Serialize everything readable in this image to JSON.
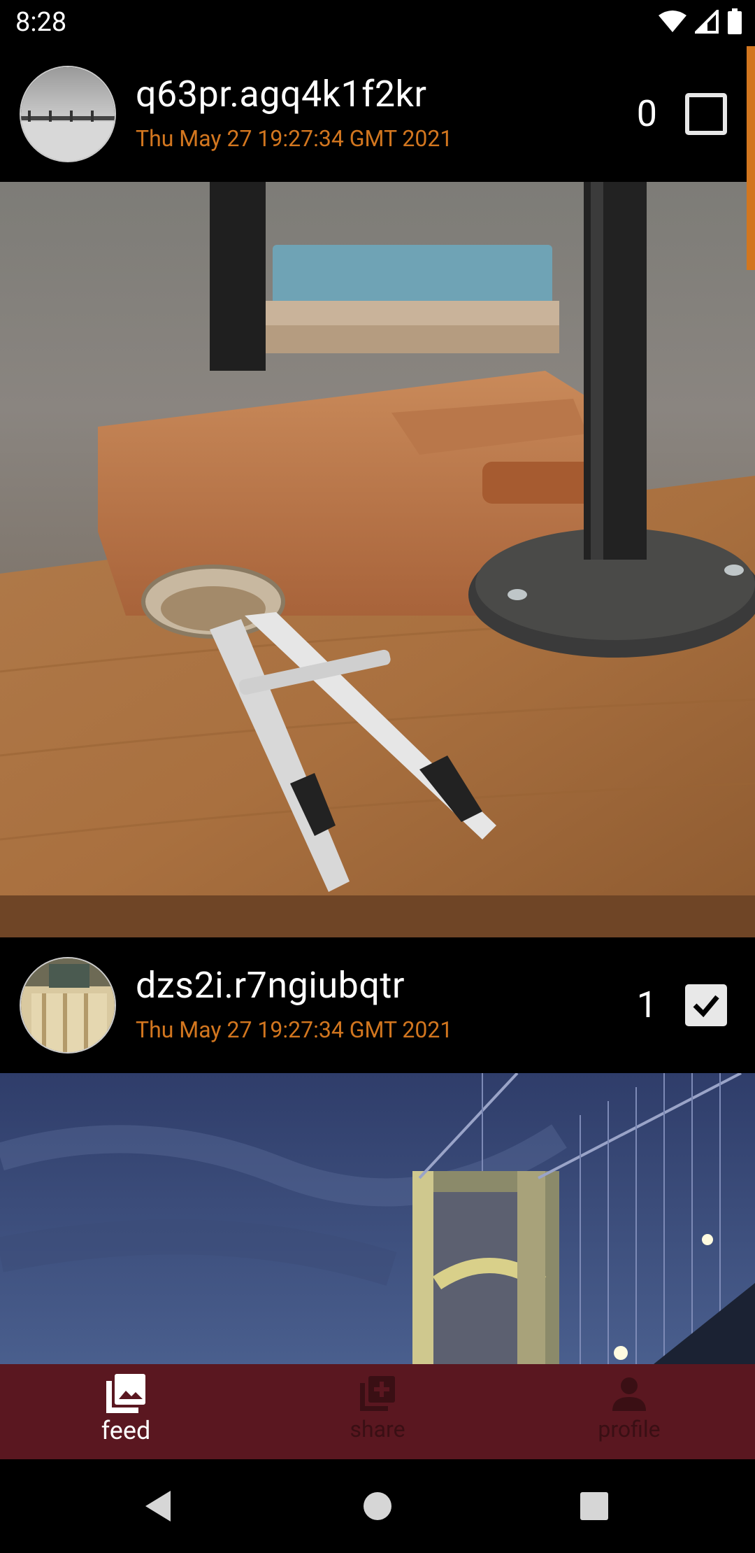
{
  "status_bar": {
    "time": "8:28",
    "icons": [
      "wifi-icon",
      "cell-signal-icon",
      "battery-icon"
    ]
  },
  "posts": [
    {
      "username": "q63pr.agq4k1f2kr",
      "date": "Thu May 27 19:27:34 GMT 2021",
      "like_count": "0",
      "liked": false
    },
    {
      "username": "dzs2i.r7ngiubqtr",
      "date": "Thu May 27 19:27:34 GMT 2021",
      "like_count": "1",
      "liked": true
    }
  ],
  "bottom_nav": {
    "items": [
      {
        "label": "feed",
        "icon": "photo-library-icon",
        "active": true
      },
      {
        "label": "share",
        "icon": "add-photo-icon",
        "active": false
      },
      {
        "label": "profile",
        "icon": "person-icon",
        "active": false
      }
    ]
  },
  "colors": {
    "accent": "#d2761f",
    "nav_background": "#5a1720",
    "nav_inactive": "#3a0f14"
  },
  "system_nav": [
    "back-icon",
    "home-icon",
    "recents-icon"
  ]
}
